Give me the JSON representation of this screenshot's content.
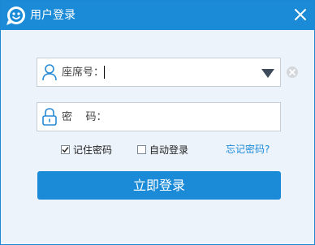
{
  "window": {
    "title": "用户登录",
    "logo_icon": "smiley-chat-icon",
    "close_icon": "close-icon"
  },
  "seat_field": {
    "label": "座席号：",
    "value": "",
    "icon": "user-icon",
    "dropdown_icon": "dropdown-triangle-icon",
    "clear_icon": "clear-circle-icon"
  },
  "password_field": {
    "label": "密    码：",
    "value": "",
    "icon": "lock-icon"
  },
  "options": {
    "remember_label": "记住密码",
    "remember_checked": true,
    "autologin_label": "自动登录",
    "autologin_checked": false,
    "forgot_label": "忘记密码?"
  },
  "login_button": {
    "label": "立即登录"
  },
  "colors": {
    "accent": "#1b8bd8",
    "background": "#ecf3fa",
    "border": "#c7ced6"
  }
}
